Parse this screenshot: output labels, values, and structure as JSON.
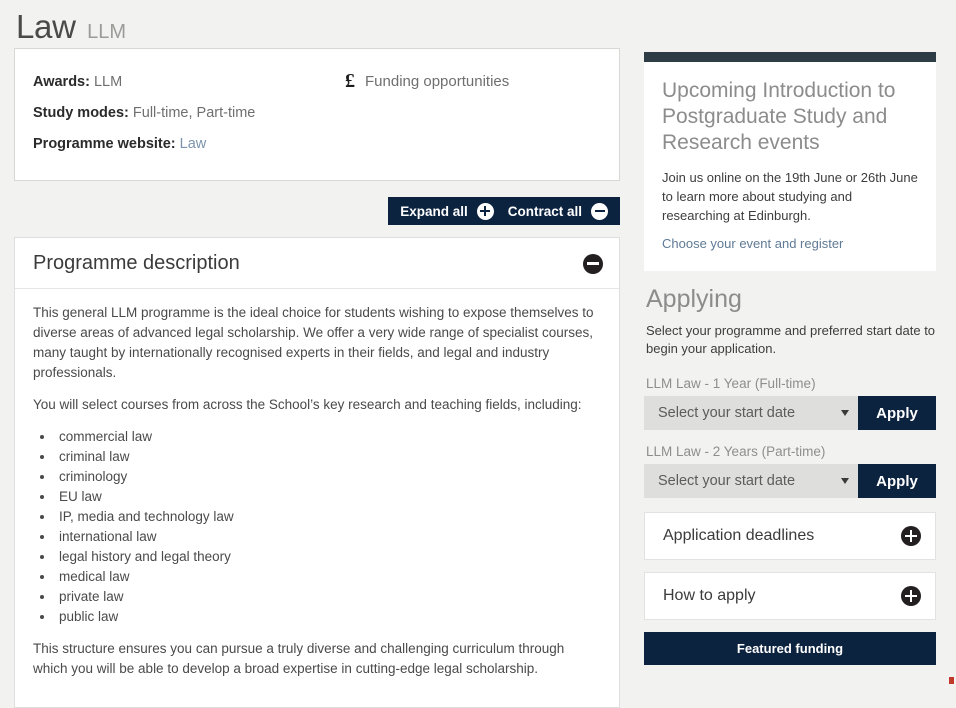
{
  "header": {
    "title": "Law",
    "subtitle": "LLM"
  },
  "summary": {
    "facts": [
      {
        "label": "Awards:",
        "value": "LLM"
      },
      {
        "label": "Study modes:",
        "value": "Full-time, Part-time"
      },
      {
        "label": "Programme website:",
        "value": "Law",
        "is_link": true
      }
    ],
    "funding_icon": "£",
    "funding_label": "Funding opportunities"
  },
  "toolbar": {
    "expand_label": "Expand all",
    "contract_label": "Contract all",
    "expand_icon": "plus-circle-icon",
    "contract_icon": "minus-circle-icon",
    "background_color": "#0c2340"
  },
  "programme": {
    "heading": "Programme description",
    "toggle_icon": "minus-circle-icon",
    "paragraph_1": "This general LLM programme is the ideal choice for students wishing to expose themselves to diverse areas of advanced legal scholarship. We offer a very wide range of specialist courses, many taught by internationally recognised experts in their fields, and legal and industry professionals.",
    "paragraph_2": "You will select courses from across the School’s key research and teaching fields, including:",
    "fields": [
      "commercial law",
      "criminal law",
      "criminology",
      "EU law",
      "IP, media and technology law",
      "international law",
      "legal history and legal theory",
      "medical law",
      "private law",
      "public law"
    ],
    "paragraph_3": "This structure ensures you can pursue a truly diverse and challenging curriculum through which you will be able to develop a broad expertise in cutting-edge legal scholarship."
  },
  "events": {
    "title": "Upcoming Introduction to Postgraduate Study and Research events",
    "body": "Join us online on the 19th June or 26th June to learn more about studying and researching at Edinburgh.",
    "link": "Choose your event and register",
    "topbar_color": "#2e3c45"
  },
  "applying": {
    "title": "Applying",
    "intro": "Select your programme and preferred start date to begin your application.",
    "options": [
      {
        "programme": "LLM Law - 1 Year (Full-time)",
        "select_value": "Select your start date",
        "apply_label": "Apply"
      },
      {
        "programme": "LLM Law - 2 Years (Part-time)",
        "select_value": "Select your start date",
        "apply_label": "Apply"
      }
    ],
    "accordions": [
      {
        "label": "Application deadlines",
        "icon": "plus-circle-icon"
      },
      {
        "label": "How to apply",
        "icon": "plus-circle-icon"
      }
    ],
    "featured_funding_label": "Featured funding"
  }
}
